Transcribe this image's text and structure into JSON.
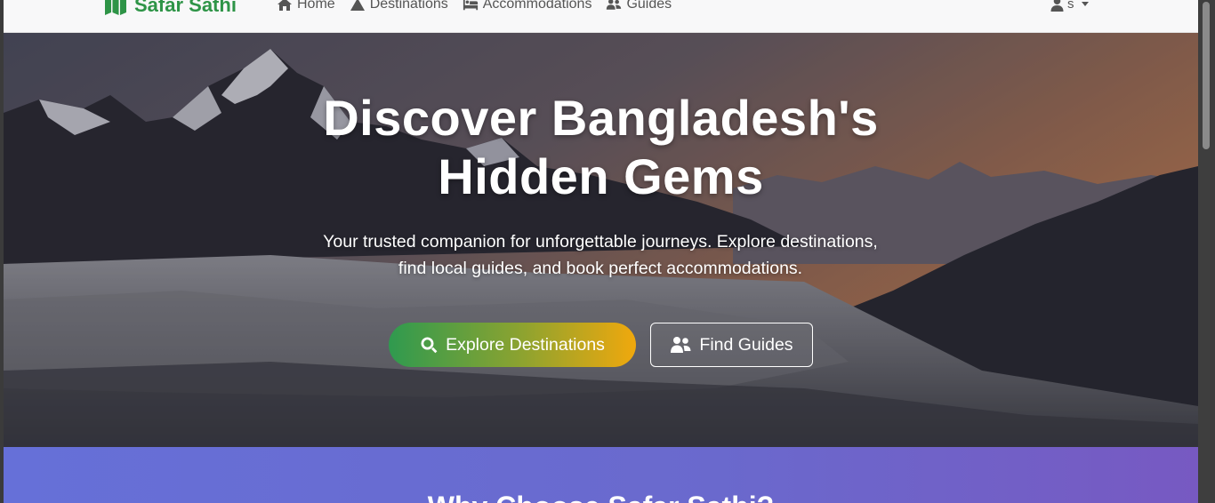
{
  "brand": {
    "name": "Safar Sathi",
    "icon": "map-icon",
    "color": "#2e9447"
  },
  "nav": {
    "links": [
      {
        "label": "Home",
        "icon": "home-icon"
      },
      {
        "label": "Destinations",
        "icon": "mountain-icon"
      },
      {
        "label": "Accommodations",
        "icon": "bed-icon"
      },
      {
        "label": "Guides",
        "icon": "users-icon"
      }
    ],
    "user": {
      "label": "s",
      "icon": "user-icon"
    }
  },
  "hero": {
    "title_line1": "Discover Bangladesh's",
    "title_line2": "Hidden Gems",
    "subtitle_line1": "Your trusted companion for unforgettable journeys. Explore destinations,",
    "subtitle_line2": "find local guides, and book perfect accommodations.",
    "primary_button": {
      "label": "Explore Destinations",
      "icon": "search-icon"
    },
    "secondary_button": {
      "label": "Find Guides",
      "icon": "users-icon"
    },
    "gradient_colors": [
      "#2f9a4f",
      "#f0a80d"
    ]
  },
  "features": {
    "title": "Why Choose Safar Sathi?",
    "background_colors": [
      "#6670d8",
      "#7759c2"
    ]
  }
}
